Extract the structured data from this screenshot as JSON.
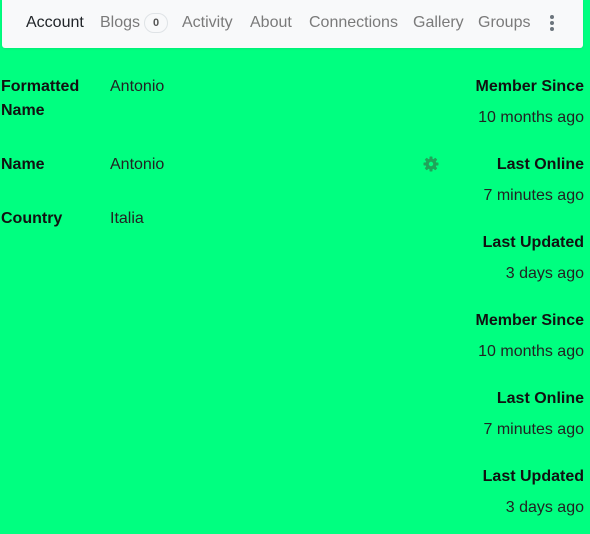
{
  "nav": {
    "tabs": [
      {
        "label": "Account"
      },
      {
        "label": "Blogs",
        "badge": "0"
      },
      {
        "label": "Activity"
      },
      {
        "label": "About"
      },
      {
        "label": "Connections"
      },
      {
        "label": "Gallery"
      },
      {
        "label": "Groups"
      }
    ],
    "more_icon": "vertical-ellipsis-icon"
  },
  "profile": {
    "fields": [
      {
        "label": "Formatted Name",
        "value": "Antonio"
      },
      {
        "label": "Name",
        "value": "Antonio"
      },
      {
        "label": "Country",
        "value": "Italia"
      }
    ],
    "settings_icon": "gear-icon"
  },
  "stats": [
    {
      "label": "Member Since",
      "value": "10 months ago"
    },
    {
      "label": "Last Online",
      "value": "7 minutes ago"
    },
    {
      "label": "Last Updated",
      "value": "3 days ago"
    },
    {
      "label": "Member Since",
      "value": "10 months ago"
    },
    {
      "label": "Last Online",
      "value": "7 minutes ago"
    },
    {
      "label": "Last Updated",
      "value": "3 days ago"
    }
  ],
  "colors": {
    "page_background": "#00ff80",
    "nav_background": "#f8f9fa",
    "gear": "#1fa45a"
  }
}
